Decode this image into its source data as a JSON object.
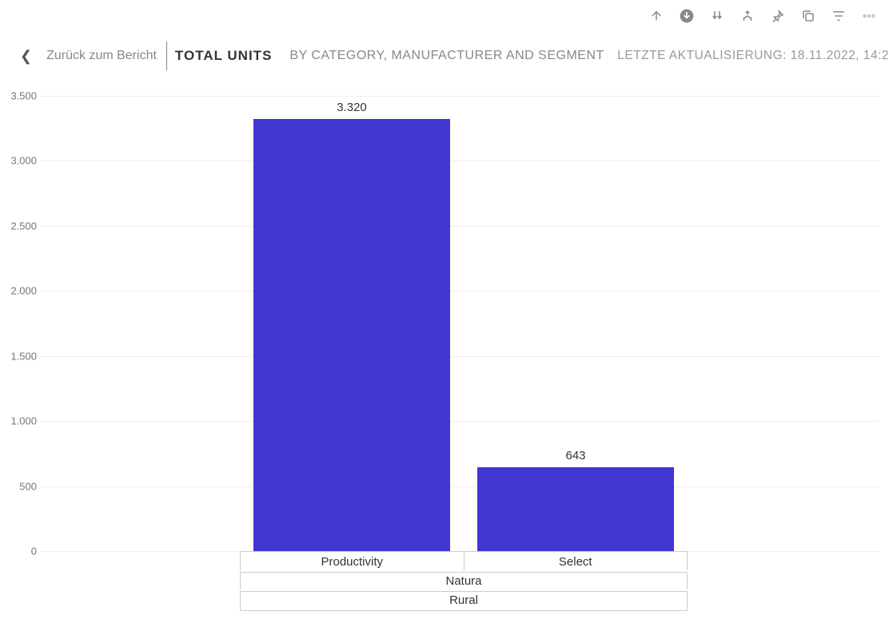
{
  "toolbar": {
    "icons": [
      "drill-up",
      "drill-down-on",
      "drill-down-all",
      "expand-level",
      "pin",
      "copy",
      "filter",
      "more"
    ]
  },
  "header": {
    "back_label": "Zurück zum Bericht",
    "title_main": "TOTAL UNITS",
    "title_sub": "BY CATEGORY, MANUFACTURER AND SEGMENT",
    "update_prefix": "LETZTE AKTUALISIERUNG:",
    "update_time": "18.11.2022, 14:2"
  },
  "chart_data": {
    "type": "bar",
    "ylim": [
      0,
      3500
    ],
    "yticks": [
      0,
      500,
      1000,
      1500,
      2000,
      2500,
      3000,
      3500
    ],
    "ytick_labels": [
      "0",
      "500",
      "1.000",
      "1.500",
      "2.000",
      "2.500",
      "3.000",
      "3.500"
    ],
    "bar_color": "#4037d0",
    "categories": [
      "Productivity",
      "Select"
    ],
    "values": [
      3320,
      643
    ],
    "value_labels": [
      "3.320",
      "643"
    ],
    "hierarchy": {
      "level1": [
        "Productivity",
        "Select"
      ],
      "level2_groups": [
        {
          "label": "Natura",
          "span": 2
        }
      ],
      "level3_groups": [
        {
          "label": "Rural",
          "span": 2
        }
      ]
    }
  }
}
